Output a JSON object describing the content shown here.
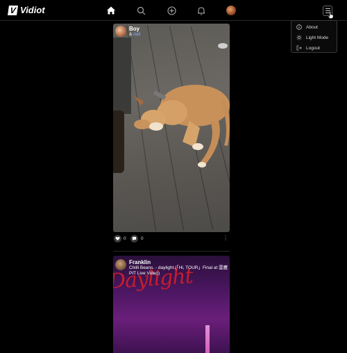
{
  "brand": {
    "logo_letter": "V",
    "name": "Vidiot"
  },
  "nav": {
    "icons": [
      "home-icon",
      "search-icon",
      "plus-circle-icon",
      "bell-icon"
    ],
    "menu_button": "hamburger-menu-icon"
  },
  "dropdown": {
    "items": [
      {
        "label": "About",
        "icon": "info-icon"
      },
      {
        "label": "Light Mode",
        "icon": "sun-icon"
      },
      {
        "label": "Logout",
        "icon": "logout-icon"
      }
    ]
  },
  "posts": [
    {
      "author": "Boy",
      "caption_prefix": "& ",
      "caption_tag": "dall",
      "likes": "0",
      "comments": "0"
    },
    {
      "author": "Franklin",
      "caption": "Chilli Beans. - daylight (「Hi, TOUR」Final at 雲鷹 PIT Live Video)",
      "overlay_text": "Daylight"
    }
  ],
  "colors": {
    "background": "#000000",
    "accent_link": "#7fb0ff",
    "border": "#2a2a2a"
  }
}
